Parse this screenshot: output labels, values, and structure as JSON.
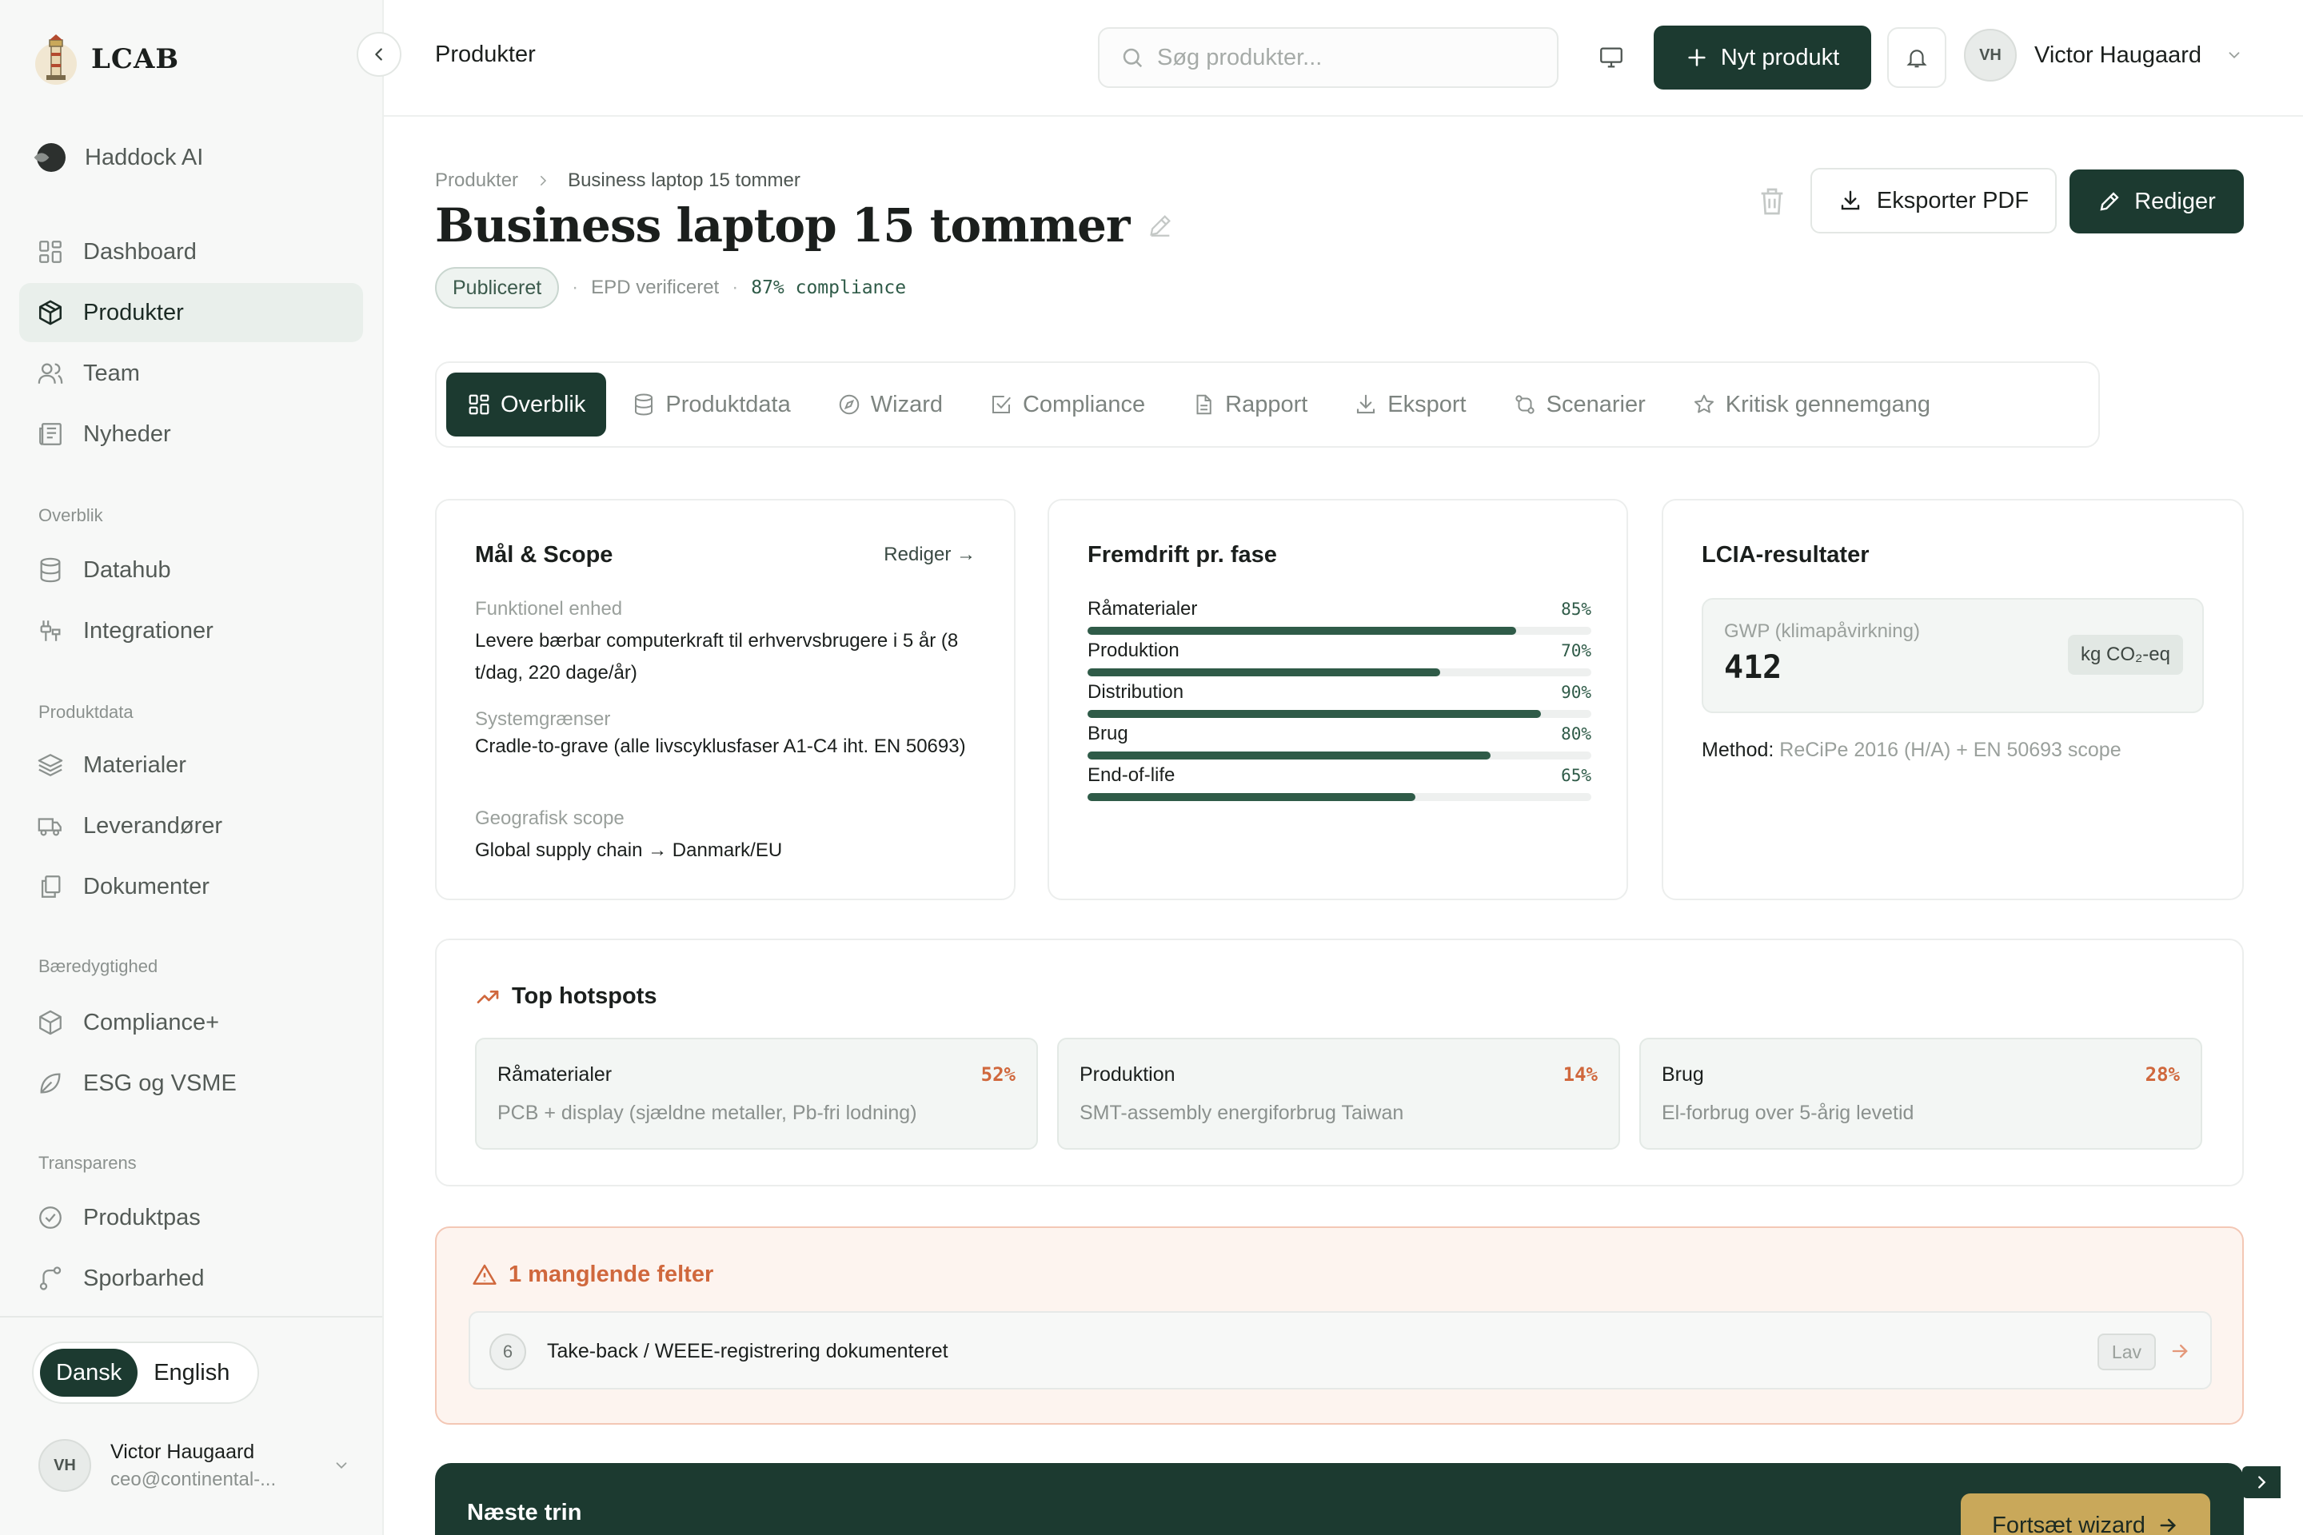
{
  "brand": {
    "name": "LCAB"
  },
  "sidebar": {
    "top_items": [
      {
        "label": "Haddock AI",
        "icon": "haddock-logo-icon"
      }
    ],
    "main_items": [
      {
        "label": "Dashboard",
        "icon": "grid-icon"
      },
      {
        "label": "Produkter",
        "icon": "box-icon",
        "active": true
      },
      {
        "label": "Team",
        "icon": "users-icon"
      },
      {
        "label": "Nyheder",
        "icon": "newspaper-icon"
      }
    ],
    "sections": [
      {
        "title": "Overblik",
        "items": [
          {
            "label": "Datahub",
            "icon": "database-icon"
          },
          {
            "label": "Integrationer",
            "icon": "plug-icon"
          }
        ]
      },
      {
        "title": "Produktdata",
        "items": [
          {
            "label": "Materialer",
            "icon": "layers-icon"
          },
          {
            "label": "Leverandører",
            "icon": "truck-icon"
          },
          {
            "label": "Dokumenter",
            "icon": "files-icon"
          }
        ]
      },
      {
        "title": "Bæredygtighed",
        "items": [
          {
            "label": "Compliance+",
            "icon": "cube-icon"
          },
          {
            "label": "ESG og VSME",
            "icon": "leaf-icon"
          }
        ]
      },
      {
        "title": "Transparens",
        "items": [
          {
            "label": "Produktpas",
            "icon": "badge-check-icon"
          },
          {
            "label": "Sporbarhed",
            "icon": "route-icon"
          }
        ]
      }
    ],
    "language": {
      "options": [
        "Dansk",
        "English"
      ],
      "active": "Dansk"
    },
    "user": {
      "initials": "VH",
      "name": "Victor Haugaard",
      "email": "ceo@continental-..."
    }
  },
  "topbar": {
    "title": "Produkter",
    "search_placeholder": "Søg produkter...",
    "new_product_label": "Nyt produkt",
    "user": {
      "initials": "VH",
      "name": "Victor Haugaard"
    }
  },
  "product": {
    "breadcrumb": [
      "Produkter",
      "Business laptop 15 tommer"
    ],
    "title": "Business laptop 15 tommer",
    "status": "Publiceret",
    "epd": "EPD verificeret",
    "compliance": "87% compliance",
    "export_label": "Eksporter PDF",
    "edit_label": "Rediger"
  },
  "tabs": [
    {
      "label": "Overblik",
      "icon": "grid-icon",
      "active": true
    },
    {
      "label": "Produktdata",
      "icon": "database-icon"
    },
    {
      "label": "Wizard",
      "icon": "compass-icon"
    },
    {
      "label": "Compliance",
      "icon": "checkbox-icon"
    },
    {
      "label": "Rapport",
      "icon": "file-text-icon"
    },
    {
      "label": "Eksport",
      "icon": "download-icon"
    },
    {
      "label": "Scenarier",
      "icon": "branch-icon"
    },
    {
      "label": "Kritisk gennemgang",
      "icon": "star-icon"
    }
  ],
  "scope": {
    "title": "Mål & Scope",
    "edit_link": "Rediger →",
    "fields": [
      {
        "label": "Funktionel enhed",
        "value": "Levere bærbar computerkraft til erhvervsbrugere i 5 år (8 t/dag, 220 dage/år)"
      },
      {
        "label": "Systemgrænser",
        "value": "Cradle-to-grave (alle livscyklusfaser A1-C4 iht. EN 50693)"
      },
      {
        "label": "Geografisk scope",
        "value": "Global supply chain → Danmark/EU"
      }
    ]
  },
  "progress": {
    "title": "Fremdrift pr. fase",
    "phases": [
      {
        "label": "Råmaterialer",
        "pct_text": "85%",
        "value": 0.85
      },
      {
        "label": "Produktion",
        "pct_text": "70%",
        "value": 0.7
      },
      {
        "label": "Distribution",
        "pct_text": "90%",
        "value": 0.9
      },
      {
        "label": "Brug",
        "pct_text": "80%",
        "value": 0.8
      },
      {
        "label": "End-of-life",
        "pct_text": "65%",
        "value": 0.65
      }
    ]
  },
  "lcia": {
    "title": "LCIA-resultater",
    "gwp_label": "GWP (klimapåvirkning)",
    "gwp_value": "412",
    "gwp_unit": "kg CO₂-eq",
    "method_label": "Method:",
    "method_value": "ReCiPe 2016 (H/A) + EN 50693 scope"
  },
  "hotspots": {
    "title": "Top hotspots",
    "items": [
      {
        "name": "Råmaterialer",
        "pct": "52%",
        "desc": "PCB + display (sjældne metaller, Pb-fri lodning)"
      },
      {
        "name": "Produktion",
        "pct": "14%",
        "desc": "SMT-assembly energiforbrug Taiwan"
      },
      {
        "name": "Brug",
        "pct": "28%",
        "desc": "El-forbrug over 5-årig levetid"
      }
    ]
  },
  "missing": {
    "title": "1 manglende felter",
    "items": [
      {
        "num": "6",
        "text": "Take-back / WEEE-registrering dokumenteret",
        "priority": "Lav"
      }
    ]
  },
  "next": {
    "title": "Næste trin",
    "button": "Fortsæt wizard"
  },
  "colors": {
    "primary": "#1c3a30",
    "accent_gold": "#c9a85a",
    "warning": "#d0683d",
    "progress": "#2f5b48"
  }
}
